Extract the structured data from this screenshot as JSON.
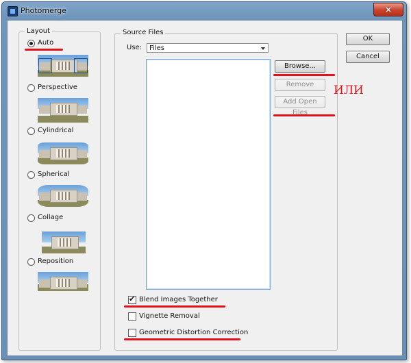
{
  "window": {
    "title": "Photomerge",
    "close_glyph": "×"
  },
  "layout": {
    "label": "Layout",
    "options": [
      {
        "label": "Auto",
        "checked": true
      },
      {
        "label": "Perspective",
        "checked": false
      },
      {
        "label": "Cylindrical",
        "checked": false
      },
      {
        "label": "Spherical",
        "checked": false
      },
      {
        "label": "Collage",
        "checked": false
      },
      {
        "label": "Reposition",
        "checked": false
      }
    ]
  },
  "source": {
    "label": "Source Files",
    "use_label": "Use:",
    "use_value": "Files",
    "browse": "Browse...",
    "remove": "Remove",
    "add_open": "Add Open Files"
  },
  "options": {
    "blend": {
      "label": "Blend Images Together",
      "checked": true
    },
    "vignette": {
      "label": "Vignette Removal",
      "checked": false
    },
    "geometric": {
      "label": "Geometric Distortion Correction",
      "checked": false
    }
  },
  "buttons": {
    "ok": "OK",
    "cancel": "Cancel"
  },
  "annotation": {
    "text": "ИЛИ",
    "color": "#d8161e"
  },
  "icons": [
    "app-icon",
    "close-icon",
    "dropdown-arrow-icon",
    "checkmark-icon"
  ]
}
